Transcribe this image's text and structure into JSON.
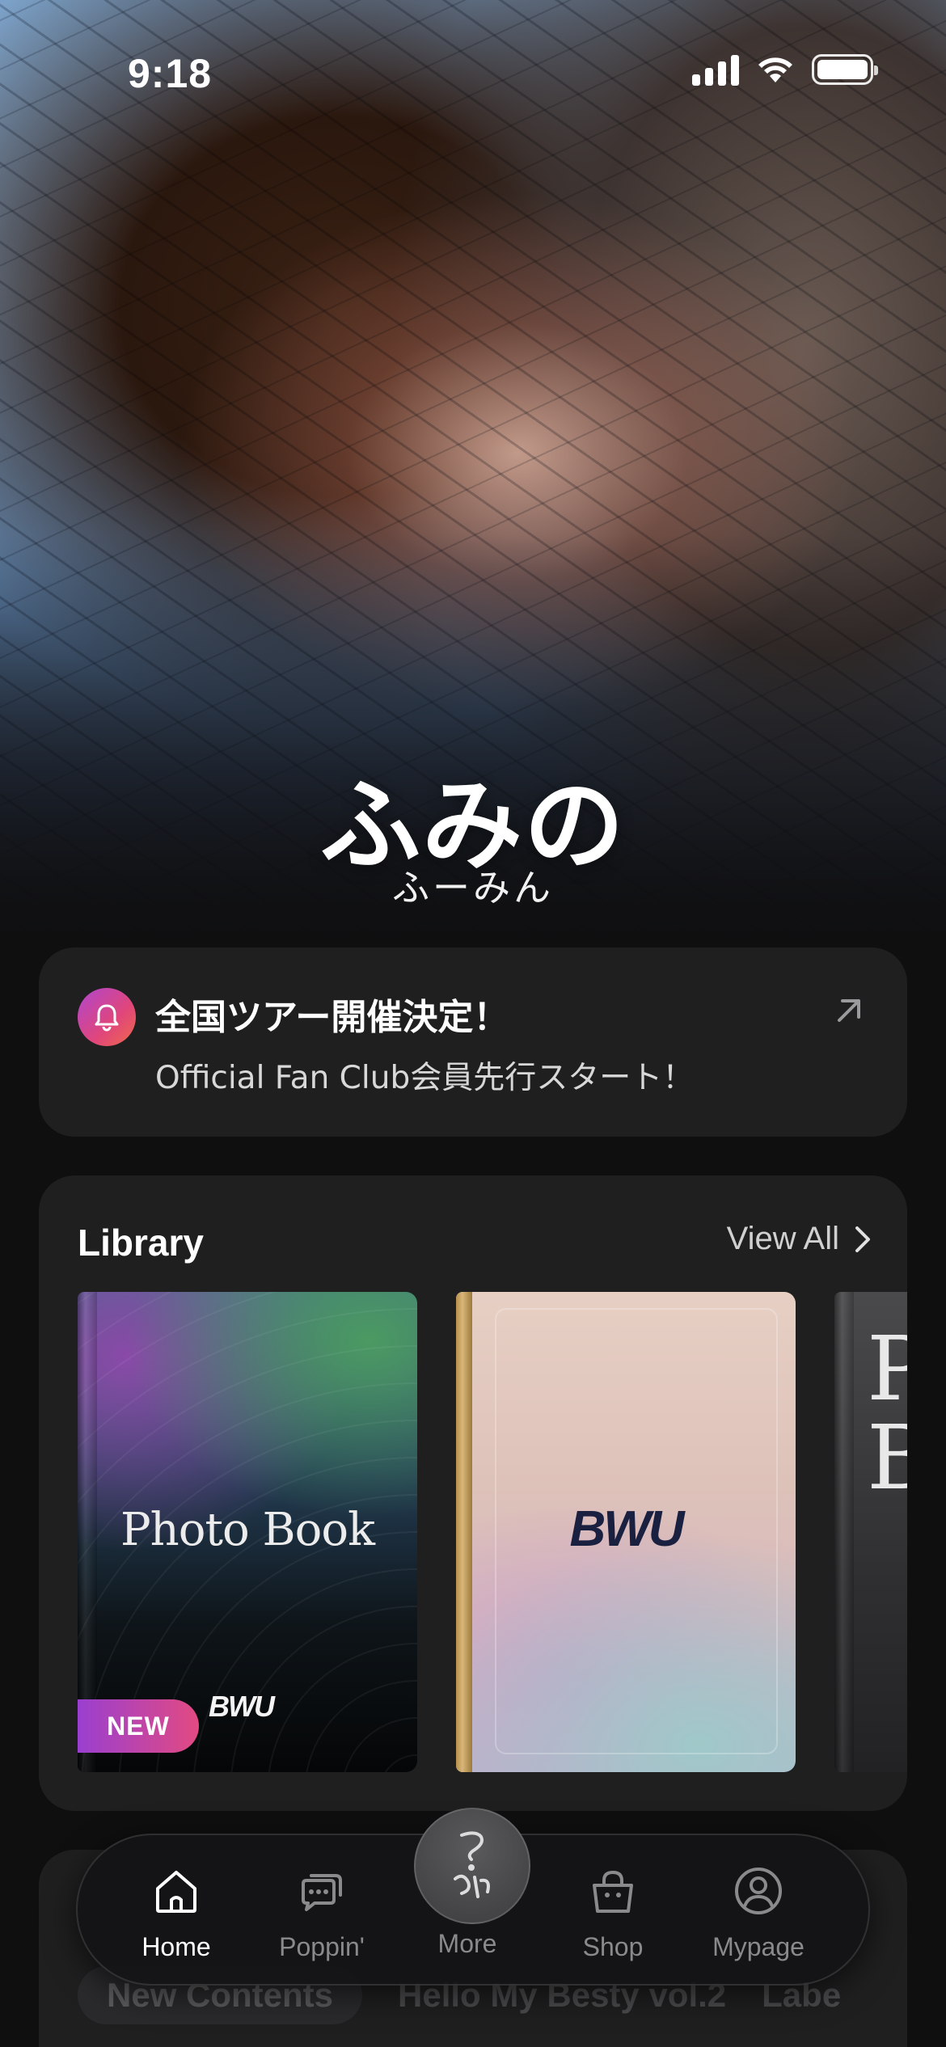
{
  "status_bar": {
    "time": "9:18"
  },
  "hero": {
    "name": "ふみの",
    "kana": "ふーみん"
  },
  "notice": {
    "title": "全国ツアー開催決定！",
    "subtitle": "Official Fan Club会員先行スタート！"
  },
  "library": {
    "title": "Library",
    "view_all": "View All",
    "books": [
      {
        "cover_text": "Photo Book",
        "badge": "NEW",
        "logo": "BWU"
      },
      {
        "logo": "BWU"
      },
      {
        "cover_text": "P\nB"
      }
    ]
  },
  "next_section": {
    "chips": [
      "New Contents",
      "Hello My Besty vol.2",
      "Labe"
    ]
  },
  "tabbar": {
    "items": [
      {
        "label": "Home",
        "icon": "home-icon",
        "active": true
      },
      {
        "label": "Poppin'",
        "icon": "chat-bubbles-icon",
        "active": false
      },
      {
        "label": "More",
        "icon": "fumino-logo-icon",
        "active": false
      },
      {
        "label": "Shop",
        "icon": "shopping-bag-icon",
        "active": false
      },
      {
        "label": "Mypage",
        "icon": "user-circle-icon",
        "active": false
      }
    ]
  },
  "colors": {
    "background": "#0f0f10",
    "card": "#1f1f20",
    "accent_gradient_start": "#9a3fd0",
    "accent_gradient_end": "#e24a82"
  }
}
